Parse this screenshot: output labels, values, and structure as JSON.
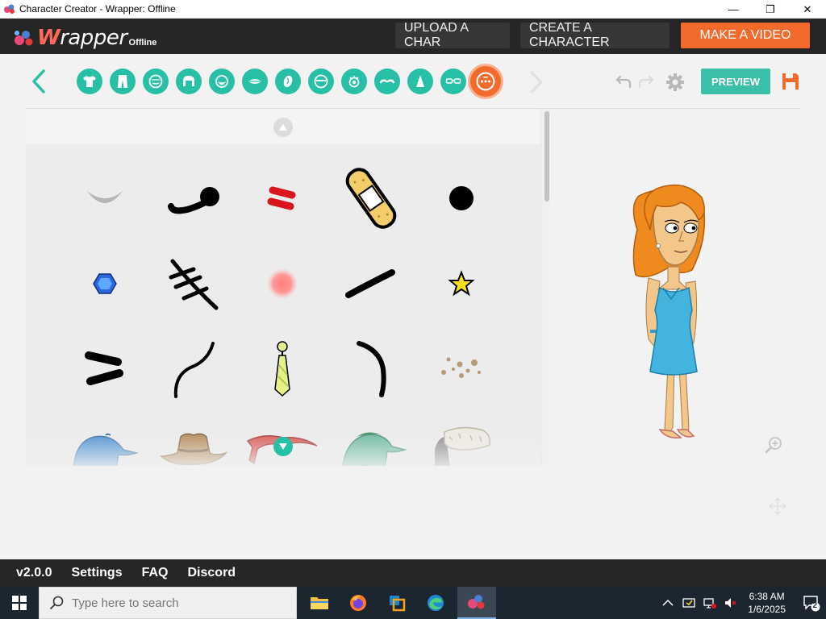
{
  "window": {
    "title": "Character Creator - Wrapper: Offline",
    "minimize_label": "—",
    "restore_label": "❐",
    "close_label": "✕"
  },
  "header": {
    "logo_w": "W",
    "logo_rest": "rapper",
    "logo_sub": "Offline",
    "upload_label": "UPLOAD A CHAR",
    "create_label": "CREATE A CHARACTER",
    "video_label": "MAKE A VIDEO"
  },
  "toolbar": {
    "categories": [
      {
        "name": "upper-body",
        "icon": "shirt-icon"
      },
      {
        "name": "lower-body",
        "icon": "pants-icon"
      },
      {
        "name": "face-shape",
        "icon": "face-icon"
      },
      {
        "name": "hair",
        "icon": "hair-icon"
      },
      {
        "name": "facial-hair",
        "icon": "beard-icon"
      },
      {
        "name": "mouth",
        "icon": "mouth-icon"
      },
      {
        "name": "ear",
        "icon": "ear-icon"
      },
      {
        "name": "head-accessory",
        "icon": "head-icon"
      },
      {
        "name": "eyes",
        "icon": "eye-icon"
      },
      {
        "name": "eyebrows",
        "icon": "eyebrow-icon"
      },
      {
        "name": "nose",
        "icon": "nose-icon"
      },
      {
        "name": "glasses",
        "icon": "glasses-icon"
      },
      {
        "name": "accessories",
        "icon": "sparkle-face-icon",
        "active": true
      }
    ],
    "preview_label": "PREVIEW"
  },
  "panel": {
    "items": [
      "crescent-mark",
      "mustache-curl",
      "red-stripes",
      "bandage",
      "black-dot",
      "blue-gem",
      "stitches-scar",
      "pink-blush",
      "black-stroke",
      "yellow-star",
      "double-stroke",
      "thin-curve",
      "necktie",
      "hook-curve",
      "freckles",
      "blue-cap",
      "cowboy-hat",
      "bandana",
      "green-cap",
      "fur-hat"
    ]
  },
  "footer": {
    "version": "v2.0.0",
    "settings": "Settings",
    "faq": "FAQ",
    "discord": "Discord"
  },
  "taskbar": {
    "search_placeholder": "Type here to search",
    "time": "6:38 AM",
    "date": "1/6/2025",
    "notification_count": "2"
  },
  "colors": {
    "accent_teal": "#27c0a6",
    "accent_orange": "#f36a2d",
    "header_bg": "#262626"
  }
}
